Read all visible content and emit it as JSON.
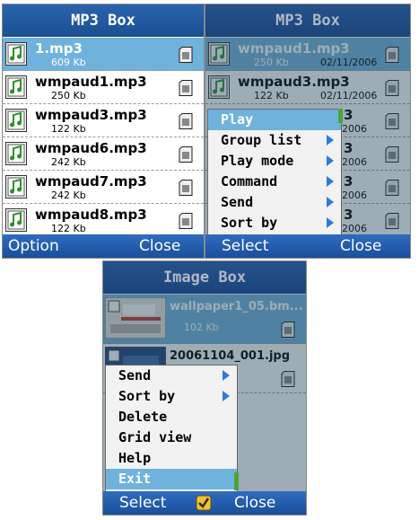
{
  "left": {
    "title": "MP3 Box",
    "files": [
      {
        "name": "1.mp3",
        "size": "609 Kb",
        "selected": true
      },
      {
        "name": "wmpaud1.mp3",
        "size": "250 Kb",
        "selected": false
      },
      {
        "name": "wmpaud3.mp3",
        "size": "122 Kb",
        "selected": false
      },
      {
        "name": "wmpaud6.mp3",
        "size": "242 Kb",
        "selected": false
      },
      {
        "name": "wmpaud7.mp3",
        "size": "242 Kb",
        "selected": false
      },
      {
        "name": "wmpaud8.mp3",
        "size": "122 Kb",
        "selected": false
      }
    ],
    "softkeys": {
      "left": "Option",
      "right": "Close"
    }
  },
  "right": {
    "title": "MP3 Box",
    "files": [
      {
        "name": "wmpaud1.mp3",
        "size": "250 Kb",
        "date": "02/11/2006",
        "selected": true
      },
      {
        "name": "wmpaud3.mp3",
        "size": "122 Kb",
        "date": "02/11/2006",
        "selected": false
      },
      {
        "name": "3",
        "date": "2006"
      },
      {
        "name": "3",
        "date": "2006"
      },
      {
        "name": "3",
        "date": "2006"
      },
      {
        "name": "3",
        "date": "2006"
      }
    ],
    "menu": [
      {
        "label": "Play",
        "submenu": false,
        "highlighted": true
      },
      {
        "label": "Group list",
        "submenu": true,
        "highlighted": false
      },
      {
        "label": "Play mode",
        "submenu": true,
        "highlighted": false
      },
      {
        "label": "Command",
        "submenu": true,
        "highlighted": false
      },
      {
        "label": "Send",
        "submenu": true,
        "highlighted": false
      },
      {
        "label": "Sort by",
        "submenu": true,
        "highlighted": false
      }
    ],
    "softkeys": {
      "left": "Select",
      "right": "Close"
    }
  },
  "bottom": {
    "title": "Image Box",
    "files": [
      {
        "name": "wallpaper1_05.bm...",
        "size": "102 Kb",
        "selected": true
      },
      {
        "name": "20061104_001.jpg",
        "selected": false
      }
    ],
    "menu": [
      {
        "label": "Send",
        "submenu": true,
        "highlighted": false
      },
      {
        "label": "Sort by",
        "submenu": true,
        "highlighted": false
      },
      {
        "label": "Delete",
        "submenu": false,
        "highlighted": false
      },
      {
        "label": "Grid view",
        "submenu": false,
        "highlighted": false
      },
      {
        "label": "Help",
        "submenu": false,
        "highlighted": false
      },
      {
        "label": "Exit",
        "submenu": false,
        "highlighted": true
      }
    ],
    "softkeys": {
      "left": "Select",
      "center_icon": "check-icon",
      "right": "Close"
    }
  },
  "colors": {
    "title_bar": "#1b4f92",
    "selection": "#6fb2dc",
    "submenu_arrow": "#2a7dd8",
    "scrollbar": "#4aa43a"
  }
}
